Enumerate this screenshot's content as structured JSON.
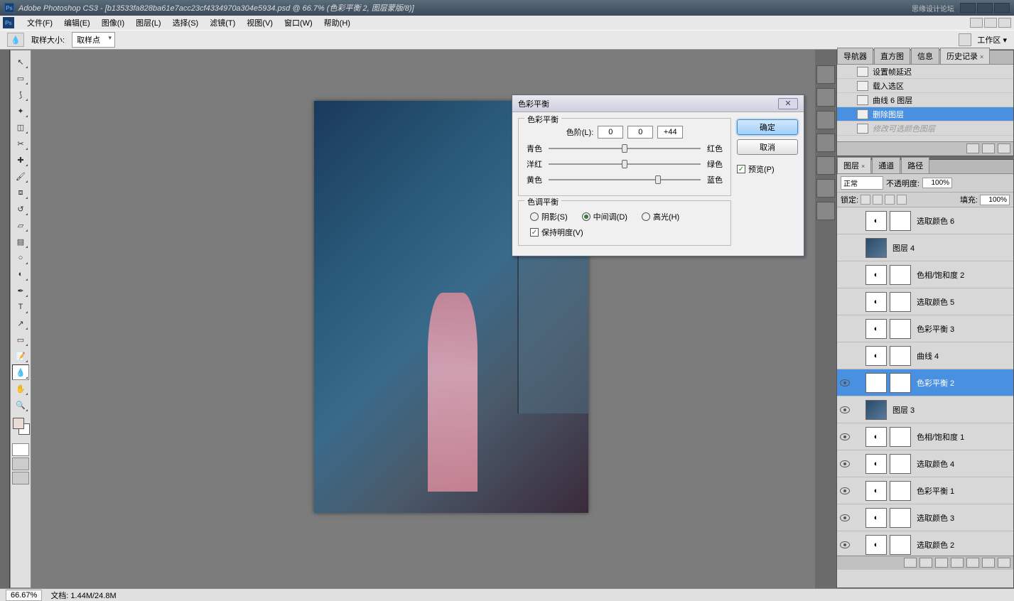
{
  "title_bar": {
    "app": "Adobe Photoshop CS3",
    "doc": "[b13533fa828ba61e7acc23cf4334970a304e5934.psd @ 66.7% (色彩平衡 2, 图层蒙版/8)]",
    "watermark": "思缘设计论坛"
  },
  "menu": [
    "文件(F)",
    "编辑(E)",
    "图像(I)",
    "图层(L)",
    "选择(S)",
    "滤镜(T)",
    "视图(V)",
    "窗口(W)",
    "帮助(H)"
  ],
  "options": {
    "label_sample": "取样大小:",
    "sample_value": "取样点",
    "workspace": "工作区 ▾"
  },
  "tools": [
    {
      "n": "move-tool",
      "g": "↖"
    },
    {
      "n": "marquee-tool",
      "g": "▭"
    },
    {
      "n": "lasso-tool",
      "g": "⟆"
    },
    {
      "n": "wand-tool",
      "g": "✦"
    },
    {
      "n": "crop-tool",
      "g": "◫"
    },
    {
      "n": "slice-tool",
      "g": "✂"
    },
    {
      "n": "healing-tool",
      "g": "✚"
    },
    {
      "n": "brush-tool",
      "g": "🖌"
    },
    {
      "n": "stamp-tool",
      "g": "⧈"
    },
    {
      "n": "history-brush",
      "g": "↺"
    },
    {
      "n": "eraser-tool",
      "g": "▱"
    },
    {
      "n": "gradient-tool",
      "g": "▤"
    },
    {
      "n": "blur-tool",
      "g": "○"
    },
    {
      "n": "dodge-tool",
      "g": "◐"
    },
    {
      "n": "pen-tool",
      "g": "✒"
    },
    {
      "n": "type-tool",
      "g": "T"
    },
    {
      "n": "path-tool",
      "g": "↗"
    },
    {
      "n": "shape-tool",
      "g": "▭"
    },
    {
      "n": "notes-tool",
      "g": "📝"
    },
    {
      "n": "eyedropper-tool",
      "g": "💧",
      "active": true
    },
    {
      "n": "hand-tool",
      "g": "✋"
    },
    {
      "n": "zoom-tool",
      "g": "🔍"
    }
  ],
  "dialog": {
    "title": "色彩平衡",
    "group1": "色彩平衡",
    "levels_label": "色阶(L):",
    "levels": [
      "0",
      "0",
      "+44"
    ],
    "rows": [
      {
        "l": "青色",
        "r": "红色",
        "pos": 50
      },
      {
        "l": "洋红",
        "r": "绿色",
        "pos": 50
      },
      {
        "l": "黄色",
        "r": "蓝色",
        "pos": 72
      }
    ],
    "group2": "色调平衡",
    "radios": [
      {
        "label": "阴影(S)",
        "on": false
      },
      {
        "label": "中间调(D)",
        "on": true
      },
      {
        "label": "高光(H)",
        "on": false
      }
    ],
    "preserve": "保持明度(V)",
    "ok": "确定",
    "cancel": "取消",
    "preview": "预览(P)"
  },
  "nav_tabs": [
    "导航器",
    "直方图",
    "信息",
    "历史记录"
  ],
  "history": [
    {
      "t": "设置帧延迟"
    },
    {
      "t": "载入选区"
    },
    {
      "t": "曲线 6 图层"
    },
    {
      "t": "删除图层",
      "sel": true
    },
    {
      "t": "修改可选颜色图层",
      "dis": true
    }
  ],
  "layers_tabs": [
    "图层",
    "通道",
    "路径"
  ],
  "layer_opts": {
    "mode": "正常",
    "opacity_l": "不透明度:",
    "opacity": "100%",
    "lock_l": "锁定:",
    "fill_l": "填充:",
    "fill": "100%"
  },
  "layers": [
    {
      "name": "选取颜色 6",
      "adj": true,
      "mask": true,
      "vis": false
    },
    {
      "name": "图层 4",
      "img": true,
      "vis": false
    },
    {
      "name": "色相/饱和度 2",
      "adj": true,
      "mask": true,
      "vis": false
    },
    {
      "name": "选取颜色 5",
      "adj": true,
      "mask": true,
      "vis": false
    },
    {
      "name": "色彩平衡 3",
      "adj": true,
      "mask": true,
      "vis": false
    },
    {
      "name": "曲线 4",
      "adj": true,
      "mask": true,
      "vis": false
    },
    {
      "name": "色彩平衡 2",
      "adj": true,
      "mask": true,
      "vis": true,
      "sel": true
    },
    {
      "name": "图层 3",
      "img": true,
      "vis": true
    },
    {
      "name": "色相/饱和度 1",
      "adj": true,
      "mask": true,
      "vis": true
    },
    {
      "name": "选取颜色 4",
      "adj": true,
      "mask": true,
      "vis": true
    },
    {
      "name": "色彩平衡 1",
      "adj": true,
      "mask": true,
      "vis": true
    },
    {
      "name": "选取颜色 3",
      "adj": true,
      "mask": true,
      "vis": true
    },
    {
      "name": "选取颜色 2",
      "adj": true,
      "mask": true,
      "vis": true
    }
  ],
  "status": {
    "zoom": "66.67%",
    "doc": "文档: 1.44M/24.8M"
  }
}
